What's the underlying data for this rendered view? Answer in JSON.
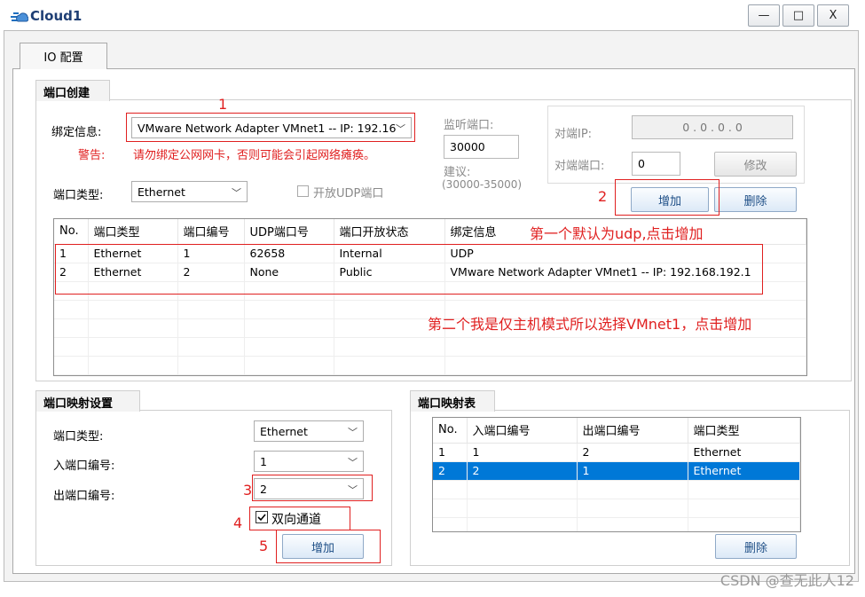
{
  "window": {
    "title": "Cloud1",
    "minimize_glyph": "—",
    "maximize_glyph": "□",
    "close_glyph": "X"
  },
  "tab": {
    "label": "IO 配置"
  },
  "port_create": {
    "title": "端口创建",
    "bind_label": "绑定信息:",
    "bind_value": "VMware Network Adapter VMnet1 -- IP: 192.16",
    "warning_label": "警告:",
    "warning_text": "请勿绑定公网网卡，否则可能会引起网络瘫痪。",
    "port_type_label": "端口类型:",
    "port_type_value": "Ethernet",
    "open_udp_label": "开放UDP端口",
    "listen_port_label": "监听端口:",
    "listen_port_value": "30000",
    "suggest_label": "建议:",
    "suggest_range": "(30000-35000)",
    "peer_ip_label": "对端IP:",
    "peer_ip_value": "0  .  0  .  0  .  0",
    "peer_port_label": "对端端口:",
    "peer_port_value": "0",
    "modify_button": "修改",
    "add_button": "增加",
    "delete_button": "删除",
    "table": {
      "headers": [
        "No.",
        "端口类型",
        "端口编号",
        "UDP端口号",
        "端口开放状态",
        "绑定信息"
      ],
      "rows": [
        [
          "1",
          "Ethernet",
          "1",
          "62658",
          "Internal",
          "UDP"
        ],
        [
          "2",
          "Ethernet",
          "2",
          "None",
          "Public",
          "VMware Network Adapter VMnet1 -- IP: 192.168.192.1"
        ]
      ]
    }
  },
  "port_map_settings": {
    "title": "端口映射设置",
    "port_type_label": "端口类型:",
    "port_type_value": "Ethernet",
    "in_port_label": "入端口编号:",
    "in_port_value": "1",
    "out_port_label": "出端口编号:",
    "out_port_value": "2",
    "bidirectional_label": "双向通道",
    "bidirectional_checked": true,
    "add_button": "增加"
  },
  "port_map_table": {
    "title": "端口映射表",
    "headers": [
      "No.",
      "入端口编号",
      "出端口编号",
      "端口类型"
    ],
    "rows": [
      [
        "1",
        "1",
        "2",
        "Ethernet"
      ],
      [
        "2",
        "2",
        "1",
        "Ethernet"
      ]
    ],
    "selected_row": 1,
    "delete_button": "删除"
  },
  "annotations": {
    "n1": "1",
    "n2": "2",
    "n3": "3",
    "n4": "4",
    "n5": "5",
    "note_udp": "第一个默认为udp,点击增加",
    "note_vmnet": "第二个我是仅主机模式所以选择VMnet1，点击增加",
    "color": "#e02020"
  },
  "watermark": "CSDN @查无此人12"
}
